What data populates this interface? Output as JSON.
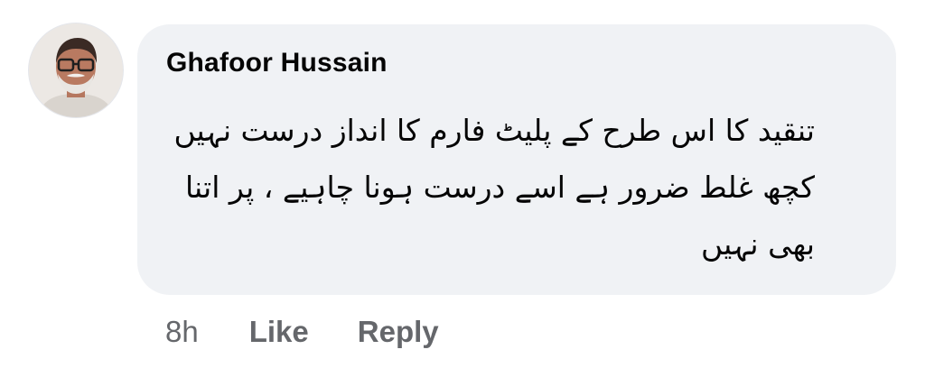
{
  "comment": {
    "author": "Ghafoor Hussain",
    "avatar_icon": "profile-photo",
    "text": "تنقید کا اس طرح کے پلیٹ فارم کا انداز درست نہیں کچھ غلط ضرور ہے اسے درست ہونا چاہیے ، پر اتنا بھی نہیں",
    "timestamp": "8h",
    "like_label": "Like",
    "reply_label": "Reply"
  },
  "colors": {
    "bubble": "#f0f2f5",
    "text": "#050505",
    "muted": "#65676b"
  }
}
